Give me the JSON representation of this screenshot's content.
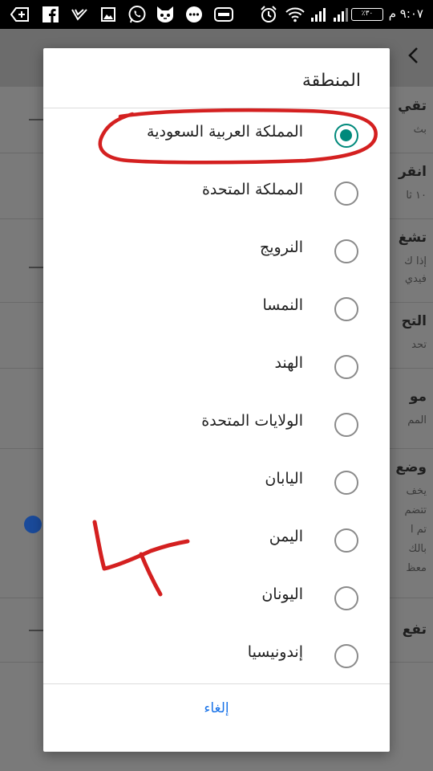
{
  "status_bar": {
    "time": "٩:٠٧ م",
    "battery": "٪٣٠",
    "icons": [
      "add-tab-icon",
      "facebook-icon",
      "check-icon",
      "image-icon",
      "whatsapp-icon",
      "cat-app-icon",
      "chat-bubble-icon",
      "game-controller-icon",
      "alarm-icon",
      "wifi-icon",
      "signal-icon",
      "signal-icon"
    ]
  },
  "background": {
    "rows": [
      {
        "title": "تقي",
        "sub": "بث"
      },
      {
        "title": "انقر",
        "sub": "١٠ ثا"
      },
      {
        "title": "تشغ",
        "sub": "إذا ك",
        "sub2": "فيدي"
      },
      {
        "title": "التح",
        "sub": "تحد"
      },
      {
        "title": "مو",
        "sub": "المم"
      },
      {
        "title": "وضع",
        "sub": "يخف",
        "sub2": "تتضم",
        "sub3": "تم ا",
        "sub4": "بالك",
        "sub5": "معظ"
      },
      {
        "title": "تفع",
        "sub": ""
      }
    ]
  },
  "dialog": {
    "title": "المنطقة",
    "options": [
      {
        "label": "المملكة العربية السعودية",
        "checked": true
      },
      {
        "label": "المملكة المتحدة",
        "checked": false
      },
      {
        "label": "النرويج",
        "checked": false
      },
      {
        "label": "النمسا",
        "checked": false
      },
      {
        "label": "الهند",
        "checked": false
      },
      {
        "label": "الولايات المتحدة",
        "checked": false
      },
      {
        "label": "اليابان",
        "checked": false
      },
      {
        "label": "اليمن",
        "checked": false
      },
      {
        "label": "اليونان",
        "checked": false
      },
      {
        "label": "إندونيسيا",
        "checked": false
      }
    ],
    "cancel": "إلغاء"
  },
  "colors": {
    "accent": "#00897b",
    "link": "#1a73e8",
    "annotation": "#d42020"
  }
}
